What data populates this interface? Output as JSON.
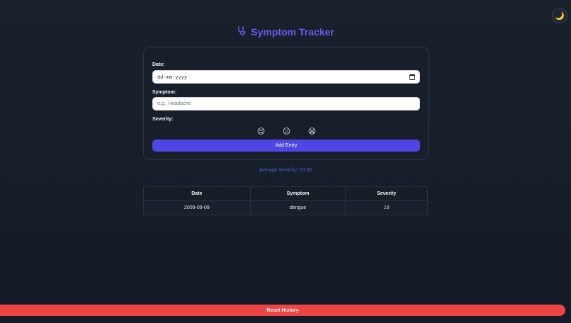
{
  "header": {
    "title": "Symptom Tracker",
    "title_icon": "stethoscope-icon",
    "theme_toggle_icon": "moon-icon",
    "theme_toggle_glyph": "🌙"
  },
  "form": {
    "date_label": "Date:",
    "date_placeholder": "dd-mm-yyyy",
    "symptom_label": "Symptom:",
    "symptom_placeholder": "e.g., Headache",
    "severity_label": "Severity:",
    "severity_options": [
      {
        "name": "mild-emoji",
        "glyph": "😌"
      },
      {
        "name": "moderate-emoji",
        "glyph": "😕"
      },
      {
        "name": "severe-emoji",
        "glyph": "😫"
      }
    ],
    "add_button": "Add Entry"
  },
  "summary": {
    "average_text": "Average Severity: 10.00"
  },
  "table": {
    "headers": [
      "Date",
      "Symptom",
      "Severity"
    ],
    "rows": [
      [
        "2009-09-09",
        "dengue",
        "10"
      ]
    ]
  },
  "footer": {
    "reset_button": "Reset History"
  },
  "colors": {
    "accent": "#4f46e5",
    "title": "#6a5cf0",
    "danger": "#ef4444",
    "background": "#151d29"
  }
}
